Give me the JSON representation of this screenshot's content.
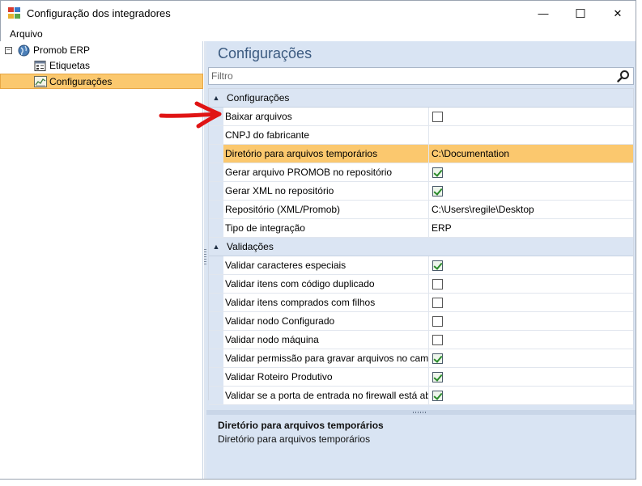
{
  "window": {
    "title": "Configuração dos integradores",
    "minimize_glyph": "—",
    "maximize_glyph": "☐",
    "close_glyph": "✕"
  },
  "menu": {
    "file_label": "Arquivo"
  },
  "tree": {
    "root": {
      "label": "Promob ERP",
      "toggle": "−",
      "icon": "globe-icon"
    },
    "children": [
      {
        "label": "Etiquetas",
        "icon": "label-icon",
        "selected": false
      },
      {
        "label": "Configurações",
        "icon": "chart-icon",
        "selected": true
      }
    ]
  },
  "main": {
    "title": "Configurações",
    "filter": {
      "placeholder": "Filtro",
      "value": ""
    }
  },
  "grid": {
    "categories": [
      {
        "label": "Configurações",
        "toggle": "▲",
        "rows": [
          {
            "name": "Baixar arquivos",
            "type": "checkbox",
            "checked": false
          },
          {
            "name": "CNPJ do fabricante",
            "type": "text",
            "value": ""
          },
          {
            "name": "Diretório para arquivos temporários",
            "type": "text",
            "value": "C:\\Documentation",
            "selected": true
          },
          {
            "name": "Gerar arquivo PROMOB no repositório",
            "type": "checkbox",
            "checked": true
          },
          {
            "name": "Gerar XML no repositório",
            "type": "checkbox",
            "checked": true
          },
          {
            "name": "Repositório (XML/Promob)",
            "type": "text",
            "value": "C:\\Users\\regile\\Desktop"
          },
          {
            "name": "Tipo de integração",
            "type": "text",
            "value": "ERP"
          }
        ]
      },
      {
        "label": "Validações",
        "toggle": "▲",
        "rows": [
          {
            "name": "Validar caracteres especiais",
            "type": "checkbox",
            "checked": true
          },
          {
            "name": "Validar itens com código duplicado",
            "type": "checkbox",
            "checked": false
          },
          {
            "name": "Validar itens comprados com filhos",
            "type": "checkbox",
            "checked": false
          },
          {
            "name": "Validar nodo Configurado",
            "type": "checkbox",
            "checked": false
          },
          {
            "name": "Validar nodo máquina",
            "type": "checkbox",
            "checked": false
          },
          {
            "name": "Validar permissão para gravar arquivos no cami...",
            "type": "checkbox",
            "checked": true
          },
          {
            "name": "Validar Roteiro Produtivo",
            "type": "checkbox",
            "checked": true
          },
          {
            "name": "Validar se a porta de entrada no firewall está ab...",
            "type": "checkbox",
            "checked": true
          }
        ]
      }
    ]
  },
  "description": {
    "title": "Diretório para arquivos temporários",
    "text": "Diretório para arquivos temporários"
  },
  "colors": {
    "selection": "#fbc86e",
    "panel_background": "#d9e4f3",
    "title_text": "#3b5a80",
    "annotation_arrow": "#e01414"
  }
}
